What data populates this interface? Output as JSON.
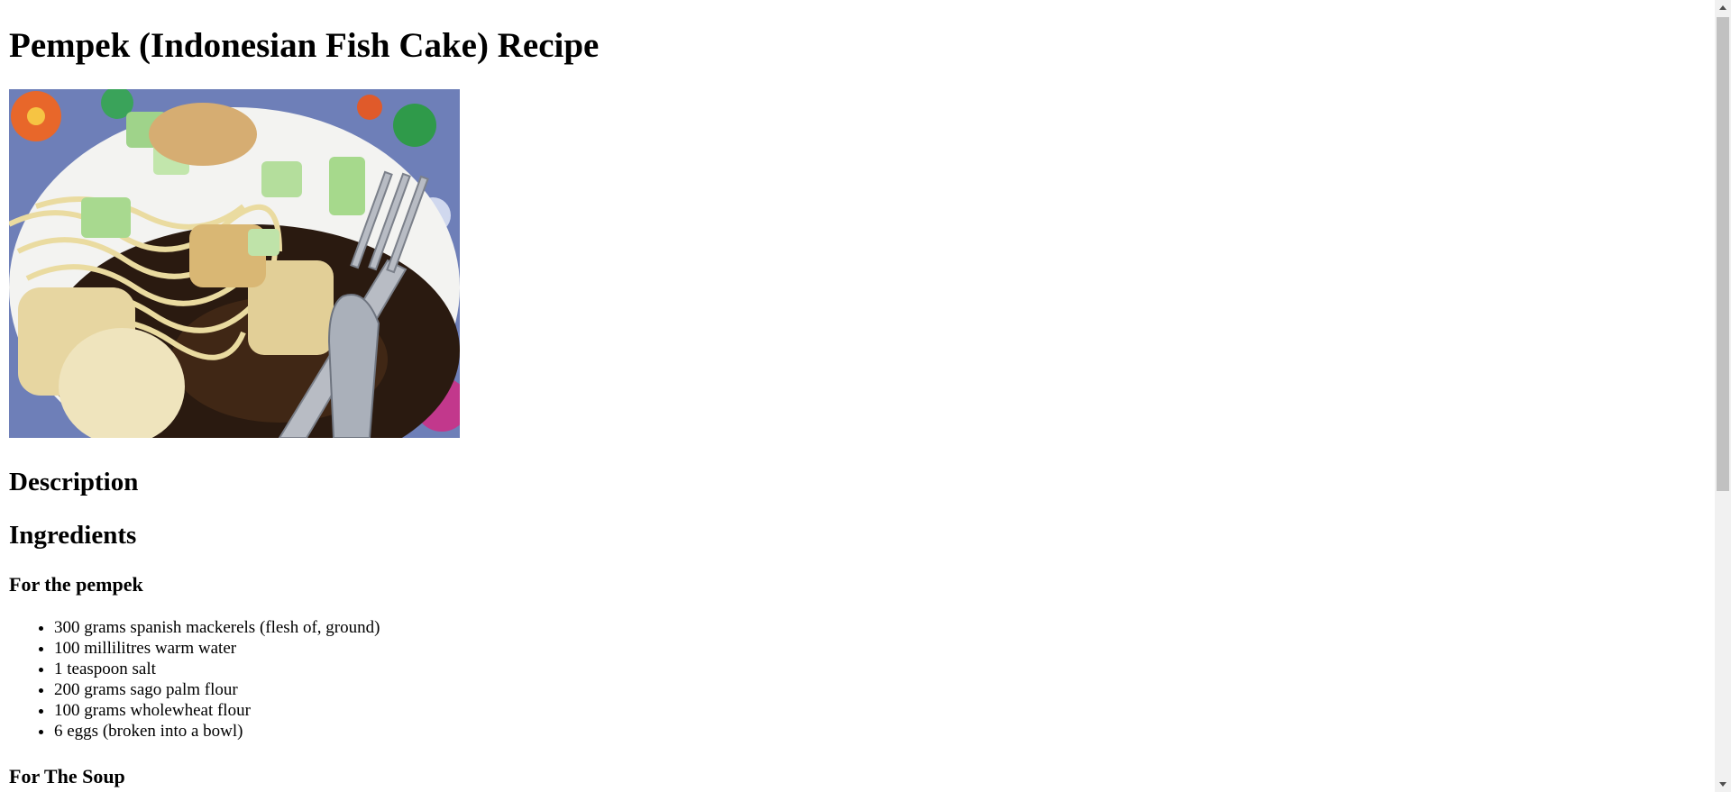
{
  "page": {
    "title": "Pempek (Indonesian Fish Cake) Recipe",
    "image_alt": "Pempek dish with noodles, cucumber and dark vinegar sauce"
  },
  "sections": {
    "description_heading": "Description",
    "ingredients_heading": "Ingredients",
    "pempek_heading": "For the pempek",
    "soup_heading": "For The Soup"
  },
  "ingredients": {
    "pempek": [
      "300 grams spanish mackerels (flesh of, ground)",
      "100 millilitres warm water",
      "1 teaspoon salt",
      "200 grams sago palm flour",
      "100 grams wholewheat flour",
      "6 eggs (broken into a bowl)"
    ]
  }
}
